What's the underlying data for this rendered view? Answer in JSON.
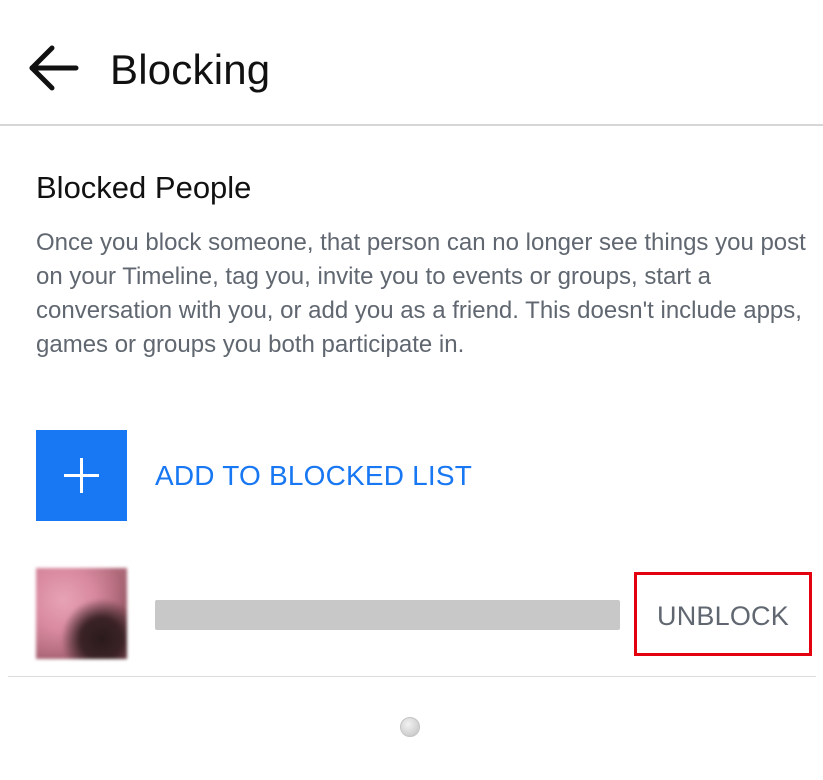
{
  "header": {
    "title": "Blocking",
    "back_icon": "arrow-left-icon"
  },
  "section": {
    "title": "Blocked People",
    "description": "Once you block someone, that person can no longer see things you post on your Timeline, tag you, invite you to events or groups, start a conversation with you, or add you as a friend. This doesn't include apps, games or groups you both participate in."
  },
  "add_to_blocked": {
    "label": "ADD TO BLOCKED LIST",
    "icon": "plus-icon"
  },
  "blocked_list": [
    {
      "name": "",
      "action_label": "UNBLOCK"
    }
  ],
  "colors": {
    "accent": "#1877f2",
    "highlight": "#e3000f",
    "muted_text": "#606770"
  }
}
